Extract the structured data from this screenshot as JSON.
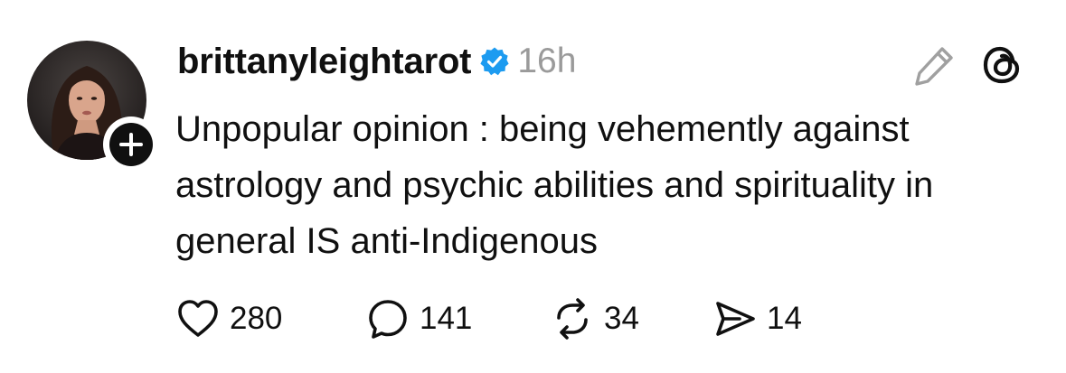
{
  "post": {
    "username": "brittanyleightarot",
    "verified": true,
    "timestamp": "16h",
    "text": "Unpopular opinion : being vehemently against astrology and psychic abilities and spirituality in general IS anti-Indigenous",
    "avatar_icon": "avatar-photo",
    "follow_icon": "plus-icon"
  },
  "header_actions": {
    "edit_icon": "pencil-icon",
    "brand_icon": "threads-logo-icon"
  },
  "actions": {
    "likes": {
      "icon": "heart-icon",
      "count": "280"
    },
    "replies": {
      "icon": "comment-bubble-icon",
      "count": "141"
    },
    "reposts": {
      "icon": "repost-icon",
      "count": "34"
    },
    "shares": {
      "icon": "send-icon",
      "count": "14"
    }
  },
  "colors": {
    "text": "#101010",
    "muted": "#9a9a9a",
    "verified_blue": "#1d9bf0",
    "icon_gray": "#a0a0a0"
  }
}
